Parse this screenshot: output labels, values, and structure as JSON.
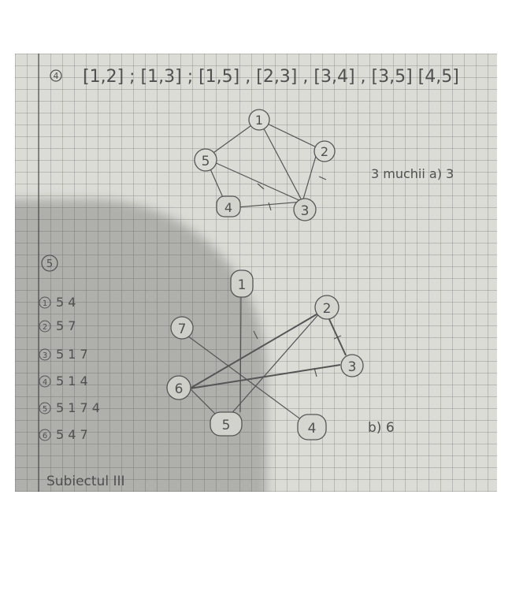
{
  "photo": {
    "problem4_label": "4",
    "edge_list": "[1,2] ; [1,3] ; [1,5] , [2,3] , [3,4] , [3,5] [4,5]",
    "graph_a": {
      "nodes": [
        "1",
        "2",
        "3",
        "4",
        "5"
      ],
      "answer": "3 muchii a) 3"
    },
    "problem5_label": "5",
    "adjacency": [
      {
        "node": "1",
        "values": "5  4"
      },
      {
        "node": "2",
        "values": "5  7"
      },
      {
        "node": "3",
        "values": "5  1  7"
      },
      {
        "node": "4",
        "values": "5  1  4"
      },
      {
        "node": "5",
        "values": "5  1  7  4"
      },
      {
        "node": "6",
        "values": "5  4  7"
      }
    ],
    "graph_b": {
      "nodes": [
        "1",
        "2",
        "7",
        "3",
        "6",
        "5",
        "4"
      ],
      "answer": "b) 6"
    },
    "footer": "Subiectul III"
  }
}
